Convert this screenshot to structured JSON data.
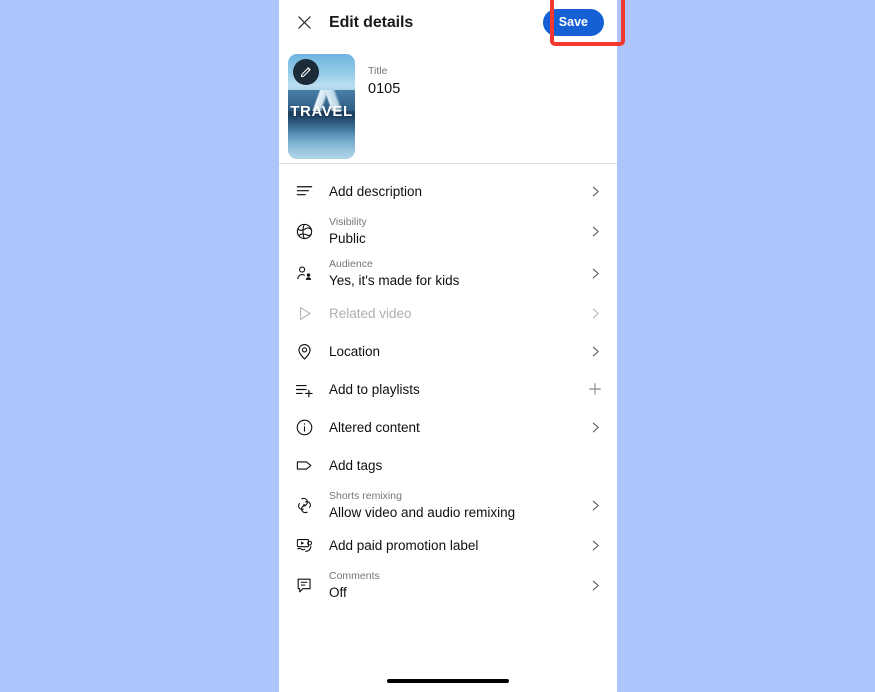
{
  "app": {
    "background_color": "#aec5fb",
    "panel_color": "#ffffff"
  },
  "header": {
    "close_icon": "close-icon",
    "title": "Edit details",
    "save_label": "Save",
    "save_color": "#1560d4",
    "highlight_color": "#f2382f"
  },
  "title_section": {
    "thumbnail": {
      "icon": "pencil-edit-icon",
      "overlay_text": "TRAVEL",
      "description": "mountain lake travel thumbnail"
    },
    "title_label": "Title",
    "title_value": "0105"
  },
  "options": [
    {
      "icon": "description-lines-icon",
      "sub": "",
      "main": "Add description",
      "trailing": "chevron-right-icon",
      "disabled": false
    },
    {
      "icon": "globe-icon",
      "sub": "Visibility",
      "main": "Public",
      "trailing": "chevron-right-icon",
      "disabled": false
    },
    {
      "icon": "audience-person-icon",
      "sub": "Audience",
      "main": "Yes, it's made for kids",
      "trailing": "chevron-right-icon",
      "disabled": false
    },
    {
      "icon": "play-triangle-icon",
      "sub": "",
      "main": "Related video",
      "trailing": "chevron-right-icon",
      "disabled": true
    },
    {
      "icon": "location-pin-icon",
      "sub": "",
      "main": "Location",
      "trailing": "chevron-right-icon",
      "disabled": false
    },
    {
      "icon": "playlist-add-icon",
      "sub": "",
      "main": "Add to playlists",
      "trailing": "plus-icon",
      "disabled": false
    },
    {
      "icon": "info-circle-icon",
      "sub": "",
      "main": "Altered content",
      "trailing": "chevron-right-icon",
      "disabled": false
    },
    {
      "icon": "tag-icon",
      "sub": "",
      "main": "Add tags",
      "trailing": "none",
      "disabled": false
    },
    {
      "icon": "shorts-remix-icon",
      "sub": "Shorts remixing",
      "main": "Allow video and audio remixing",
      "trailing": "chevron-right-icon",
      "disabled": false
    },
    {
      "icon": "paid-promotion-icon",
      "sub": "",
      "main": "Add paid promotion label",
      "trailing": "chevron-right-icon",
      "disabled": false
    },
    {
      "icon": "comment-icon",
      "sub": "Comments",
      "main": "Off",
      "trailing": "chevron-right-icon",
      "disabled": false
    }
  ],
  "home_indicator": "home-indicator-bar"
}
